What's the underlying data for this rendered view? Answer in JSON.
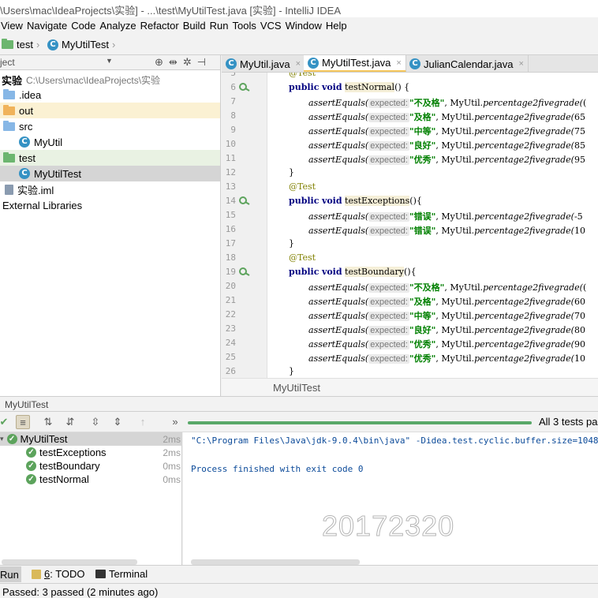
{
  "window": {
    "title": "\\Users\\mac\\IdeaProjects\\实验] - ...\\test\\MyUtilTest.java [实验] - IntelliJ IDEA"
  },
  "menu": [
    "View",
    "Navigate",
    "Code",
    "Analyze",
    "Refactor",
    "Build",
    "Run",
    "Tools",
    "VCS",
    "Window",
    "Help"
  ],
  "breadcrumb": {
    "folder": "test",
    "file": "MyUtilTest"
  },
  "project": {
    "header": "ject",
    "root_name": "实验",
    "root_path": "C:\\Users\\mac\\IdeaProjects\\实验",
    "items": [
      ".idea",
      "out",
      "src",
      "MyUtil",
      "test",
      "MyUtilTest",
      "实验.iml",
      "External Libraries"
    ]
  },
  "tabs": [
    {
      "label": "MyUtil.java",
      "close": "×"
    },
    {
      "label": "MyUtilTest.java",
      "close": "×"
    },
    {
      "label": "JulianCalendar.java",
      "close": "×"
    }
  ],
  "code": {
    "line_numbers": [
      "5",
      "6",
      "7",
      "8",
      "9",
      "10",
      "11",
      "12",
      "13",
      "14",
      "15",
      "16",
      "17",
      "18",
      "19",
      "20",
      "21",
      "22",
      "23",
      "24",
      "25",
      "26"
    ],
    "kw_public": "public",
    "kw_void": "void",
    "annotation": "@Test",
    "methods": [
      "testNormal",
      "testExceptions",
      "testBoundary"
    ],
    "assert_fn": "assertEquals(",
    "hint": "expected:",
    "call_prefix": ", MyUtil.",
    "call_fn": "percentage2fivegrade(",
    "normal_rows": [
      {
        "str": "\"不及格\"",
        "arg": "("
      },
      {
        "str": "\"及格\"",
        "arg": "65"
      },
      {
        "str": "\"中等\"",
        "arg": "75"
      },
      {
        "str": "\"良好\"",
        "arg": "85"
      },
      {
        "str": "\"优秀\"",
        "arg": "95"
      }
    ],
    "exception_rows": [
      {
        "str": "\"错误\"",
        "arg": "-5"
      },
      {
        "str": "\"错误\"",
        "arg": "10"
      }
    ],
    "boundary_rows": [
      {
        "str": "\"不及格\"",
        "arg": "("
      },
      {
        "str": "\"及格\"",
        "arg": "60"
      },
      {
        "str": "\"中等\"",
        "arg": "70"
      },
      {
        "str": "\"良好\"",
        "arg": "80"
      },
      {
        "str": "\"优秀\"",
        "arg": "90"
      },
      {
        "str": "\"优秀\"",
        "arg": "10"
      }
    ],
    "sig_tail_1": "() {",
    "sig_tail_2": "(){",
    "close_brace": "}"
  },
  "editor_footer": "MyUtilTest",
  "run": {
    "header": "MyUtilTest",
    "summary": "All 3 tests pas",
    "tests": [
      {
        "name": "MyUtilTest",
        "duration": "2ms"
      },
      {
        "name": "testExceptions",
        "duration": "2ms"
      },
      {
        "name": "testBoundary",
        "duration": "0ms"
      },
      {
        "name": "testNormal",
        "duration": "0ms"
      }
    ],
    "console": [
      "\"C:\\Program Files\\Java\\jdk-9.0.4\\bin\\java\" -Didea.test.cyclic.buffer.size=1048576 \"-ja",
      "Process finished with exit code 0"
    ],
    "watermark": "20172320"
  },
  "bottom_tabs": {
    "run": "Run",
    "todo_num": "6",
    "todo": ": TODO",
    "terminal": "Terminal"
  },
  "status": "Passed: 3 passed (2 minutes ago)",
  "colors": {
    "accent_tab": "#f5c65b",
    "pass_green": "#5ca35c",
    "progress": "#59a869",
    "folder_blue": "#87b7e6",
    "folder_orange": "#f0b35a",
    "folder_green": "#6cb66f"
  }
}
